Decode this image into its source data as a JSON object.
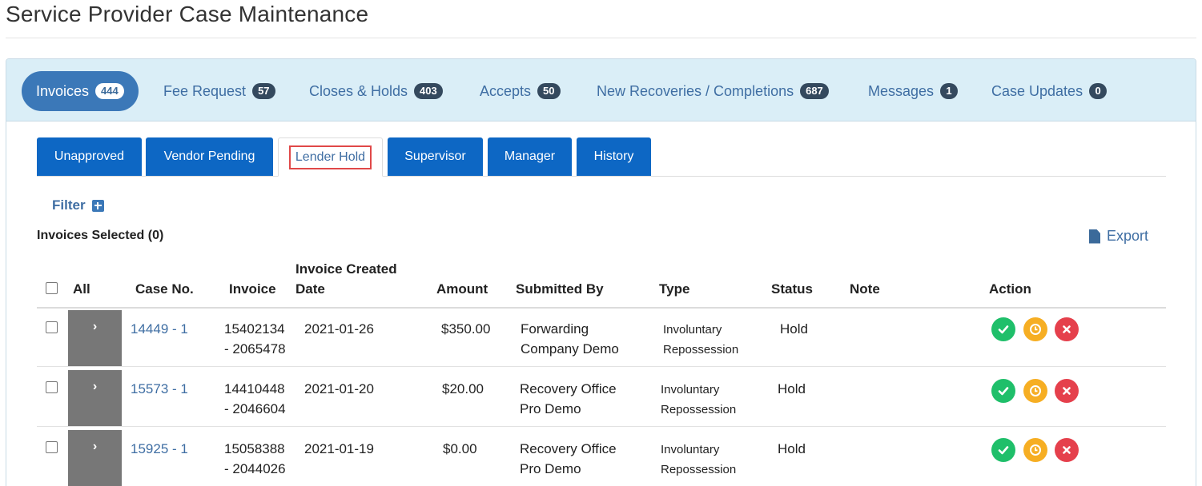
{
  "page_title": "Service Provider Case Maintenance",
  "top_tabs": [
    {
      "label": "Invoices",
      "count": "444",
      "active": true
    },
    {
      "label": "Fee Request",
      "count": "57"
    },
    {
      "label": "Closes & Holds",
      "count": "403"
    },
    {
      "label": "Accepts",
      "count": "50"
    },
    {
      "label": "New Recoveries / Completions",
      "count": "687"
    },
    {
      "label": "Messages",
      "count": "1"
    },
    {
      "label": "Case Updates",
      "count": "0"
    }
  ],
  "sub_tabs": [
    {
      "label": "Unapproved"
    },
    {
      "label": "Vendor Pending"
    },
    {
      "label": "Lender Hold",
      "active": true
    },
    {
      "label": "Supervisor"
    },
    {
      "label": "Manager"
    },
    {
      "label": "History"
    }
  ],
  "filter_label": "Filter",
  "selected_label": "Invoices Selected (0)",
  "export_label": "Export",
  "table": {
    "headers": {
      "all": "All",
      "case_no": "Case No.",
      "invoice": "Invoice",
      "created_line1": "Invoice Created",
      "created_line2": "Date",
      "amount": "Amount",
      "submitted_by": "Submitted By",
      "type": "Type",
      "status": "Status",
      "note": "Note",
      "action": "Action"
    },
    "rows": [
      {
        "case_no": "14449 - 1",
        "invoice_line1": "15402134",
        "invoice_line2": "- 2065478",
        "date": "2021-01-26",
        "amount": "$350.00",
        "submitted_line1": "Forwarding",
        "submitted_line2": "Company Demo",
        "type_line1": "Involuntary",
        "type_line2": "Repossession",
        "status": "Hold",
        "note": ""
      },
      {
        "case_no": "15573 - 1",
        "invoice_line1": "14410448",
        "invoice_line2": "- 2046604",
        "date": "2021-01-20",
        "amount": "$20.00",
        "submitted_line1": "Recovery Office",
        "submitted_line2": "Pro Demo",
        "type_line1": "Involuntary",
        "type_line2": "Repossession",
        "status": "Hold",
        "note": ""
      },
      {
        "case_no": "15925 - 1",
        "invoice_line1": "15058388",
        "invoice_line2": "- 2044026",
        "date": "2021-01-19",
        "amount": "$0.00",
        "submitted_line1": "Recovery Office",
        "submitted_line2": "Pro Demo",
        "type_line1": "Involuntary",
        "type_line2": "Repossession",
        "status": "Hold",
        "note": ""
      }
    ]
  },
  "icons": {
    "approve": "check-circle-icon",
    "hold": "clock-circle-icon",
    "reject": "x-circle-icon",
    "expand": "chevron-right-icon",
    "filter": "plus-square-icon",
    "export": "file-icon"
  },
  "colors": {
    "tab_bar_bg": "#daeef7",
    "active_tab": "#3b78b8",
    "sub_tab": "#0d67c4",
    "badge": "#34495e",
    "link": "#3f6ea3",
    "approve": "#1fbf6a",
    "hold": "#f6ae23",
    "reject": "#e5404c",
    "highlight_border": "#e04848"
  }
}
